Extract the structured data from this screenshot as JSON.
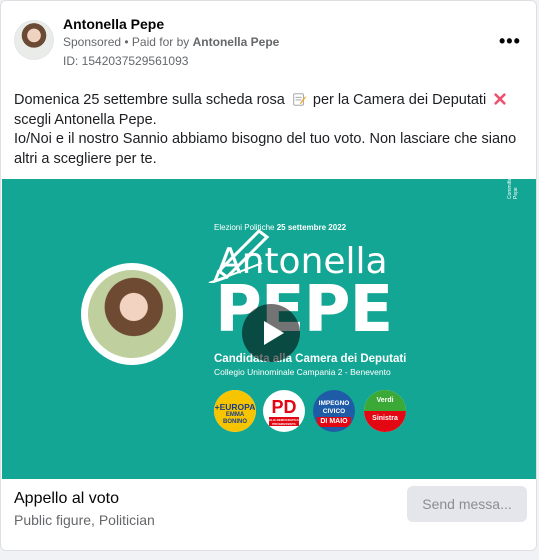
{
  "post": {
    "author": "Antonella Pepe",
    "sponsored": "Sponsored",
    "paid_prefix": "• Paid for by",
    "paid_by": "Antonella Pepe",
    "id_line": "ID: 1542037529561093",
    "more_label": "•••",
    "text_line1_a": "Domenica 25 settembre sulla scheda rosa",
    "text_line1_b": "per la Camera dei Deputati",
    "text_line2": "scegli Antonella Pepe.",
    "text_line3": "Io/Noi e il nostro Sannio abbiamo bisogno del tuo voto. Non lasciare che siano altri a scegliere per te."
  },
  "creative": {
    "elez_prefix": "Elezioni Politiche",
    "elez_date": "25 settembre 2022",
    "first_name": "Antonella",
    "last_name": "PEPE",
    "candidacy": "Candidata alla Camera dei Deputati",
    "college": "Collegio Uninominale Campania 2 - Benevento",
    "vertical_text": "Committente Responsabile Antonella Pepe",
    "logos": {
      "europa": [
        "+EUROPA",
        "EMMA",
        "BONINO"
      ],
      "pd": [
        "PD",
        "ITALIA DEMOCRATICA E PROGRESSISTA"
      ],
      "impegno": [
        "IMPEGNO",
        "CIVICO",
        "DI MAIO"
      ],
      "avs": [
        "Verdi",
        "Sinistra"
      ]
    }
  },
  "footer": {
    "title": "Appello al voto",
    "subtitle": "Public figure, Politician",
    "send_button": "Send messa..."
  },
  "colors": {
    "creative_bg": "#14a694",
    "pd_red": "#e30613",
    "pd_green": "#009246",
    "impegno_blue": "#1f5ca8",
    "europa_yellow": "#f7c400"
  }
}
